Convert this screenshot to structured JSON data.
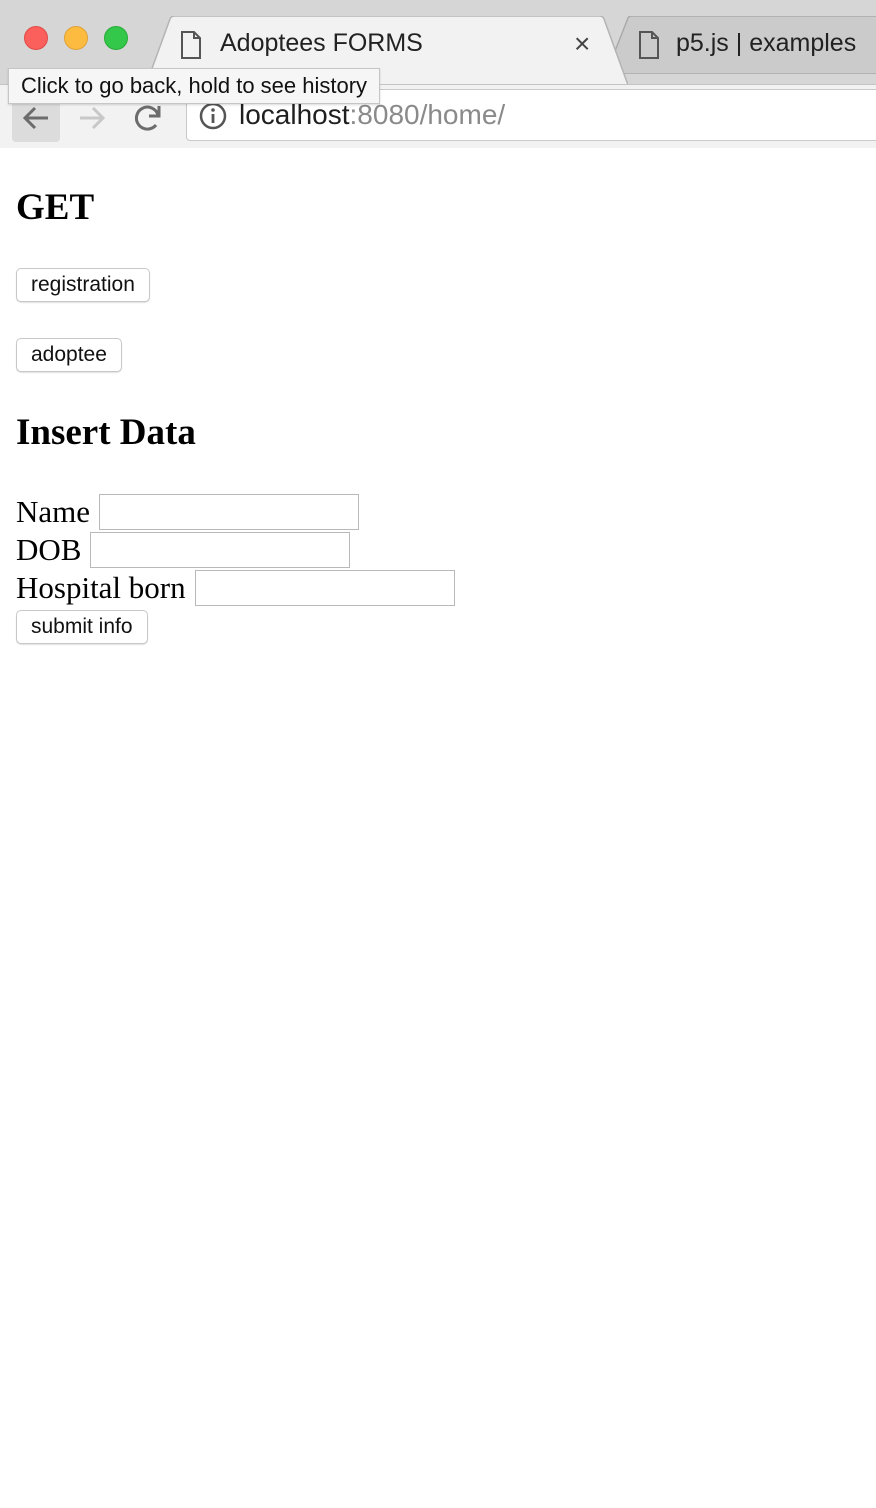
{
  "browser": {
    "tabs": [
      {
        "title": "Adoptees FORMS",
        "active": true
      },
      {
        "title": "p5.js | examples",
        "active": false
      }
    ],
    "tab_close_glyph": "×",
    "address": {
      "host": "localhost",
      "rest": ":8080/home/"
    },
    "tooltip": "Click to go back, hold to see history",
    "icons": {
      "back": "back-arrow-icon",
      "forward": "forward-arrow-icon",
      "reload": "reload-icon",
      "info": "info-icon",
      "tab": "document-icon"
    },
    "colors": {
      "close": "#fc605c",
      "minimize": "#fdbc40",
      "maximize": "#34c84a"
    }
  },
  "page": {
    "get_heading": "GET",
    "get_buttons": {
      "registration": "registration",
      "adoptee": "adoptee"
    },
    "insert_heading": "Insert Data",
    "form": {
      "name_label": "Name",
      "name_value": "",
      "dob_label": "DOB",
      "dob_value": "",
      "hospital_label": "Hospital born",
      "hospital_value": "",
      "submit_label": "submit info"
    }
  }
}
